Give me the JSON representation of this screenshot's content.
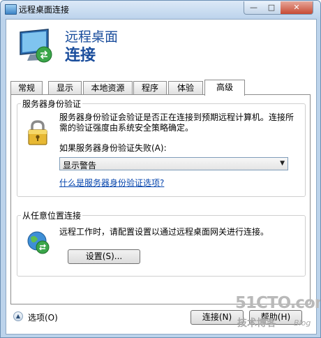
{
  "window": {
    "title": "远程桌面连接",
    "caption_min": "—",
    "caption_max": "□",
    "caption_close": "✕"
  },
  "banner": {
    "line1": "远程桌面",
    "line2": "连接"
  },
  "tabs": [
    {
      "label": "常规"
    },
    {
      "label": "显示"
    },
    {
      "label": "本地资源"
    },
    {
      "label": "程序"
    },
    {
      "label": "体验"
    },
    {
      "label": "高级",
      "active": true
    }
  ],
  "auth_group": {
    "title": "服务器身份验证",
    "description": "服务器身份验证会验证是否正在连接到预期远程计算机。连接所需的验证强度由系统安全策略确定。",
    "fail_label": "如果服务器身份验证失败(A):",
    "select_value": "显示警告",
    "link": "什么是服务器身份验证选项?"
  },
  "gateway_group": {
    "title": "从任意位置连接",
    "description": "远程工作时，请配置设置以通过远程桌面网关进行连接。",
    "settings_button": "设置(S)..."
  },
  "footer": {
    "options_label": "选项(O)",
    "connect_button": "连接(N)",
    "help_button": "帮助(H)"
  },
  "watermark": {
    "site": "51CTO.com",
    "line2": "技术博客",
    "line3": "Blog"
  },
  "colors": {
    "link": "#0645ad",
    "banner_text": "#1a4d9c",
    "frame": "#bcd3eb"
  }
}
